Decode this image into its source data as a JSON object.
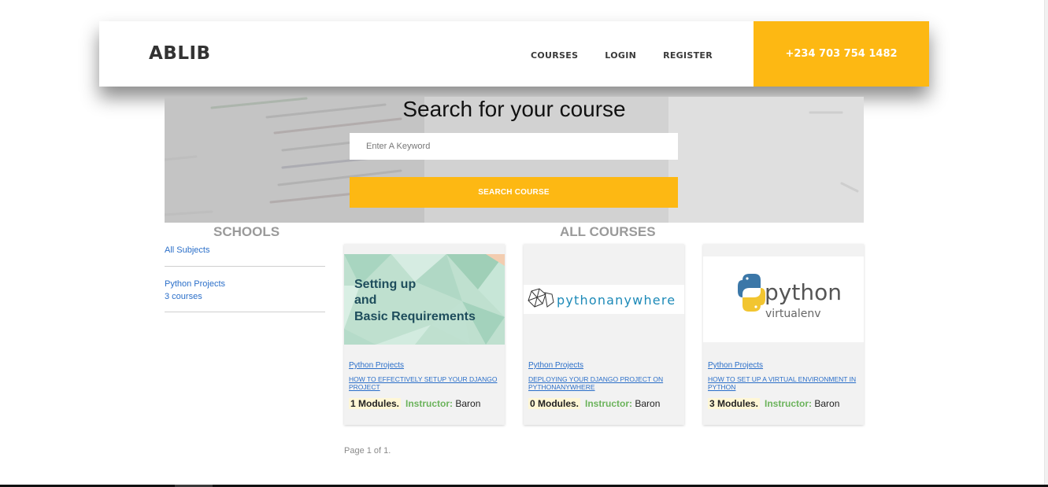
{
  "header": {
    "brand": "ABLIB",
    "nav": [
      "COURSES",
      "LOGIN",
      "REGISTER"
    ],
    "phone": "+234 703 754 1482"
  },
  "hero": {
    "title": "Search for your course",
    "search_placeholder": "Enter A Keyword",
    "search_button": "SEARCH COURSE"
  },
  "schools": {
    "heading": "SCHOOLS",
    "items": [
      {
        "label": "All Subjects"
      },
      {
        "label": "Python Projects",
        "count": "3 courses"
      }
    ]
  },
  "courses": {
    "heading": "ALL COURSES",
    "cards": [
      {
        "thumb_text": [
          "Setting up",
          "and",
          "Basic Requirements"
        ],
        "category": "Python Projects",
        "title": "HOW TO EFFECTIVELY SETUP YOUR DJANGO PROJECT",
        "modules": "1 Modules.",
        "instructor_label": "Instructor:",
        "instructor": "Baron"
      },
      {
        "thumb_text": [
          "pythonanywhere"
        ],
        "category": "Python Projects",
        "title": "DEPLOYING YOUR DJANGO PROJECT ON PYTHONANYWHERE",
        "modules": "0 Modules.",
        "instructor_label": "Instructor:",
        "instructor": "Baron"
      },
      {
        "thumb_text": [
          "python",
          "virtualenv"
        ],
        "category": "Python Projects",
        "title": "HOW TO SET UP A VIRTUAL ENVIRONMENT IN PYTHON",
        "modules": "3 Modules.",
        "instructor_label": "Instructor:",
        "instructor": "Baron"
      }
    ]
  },
  "pagination": "Page 1 of 1.",
  "colors": {
    "accent": "#fdb813",
    "link": "#2b6fc9",
    "instructor": "#6bb35b",
    "heading_grey": "#9a9a9a"
  }
}
